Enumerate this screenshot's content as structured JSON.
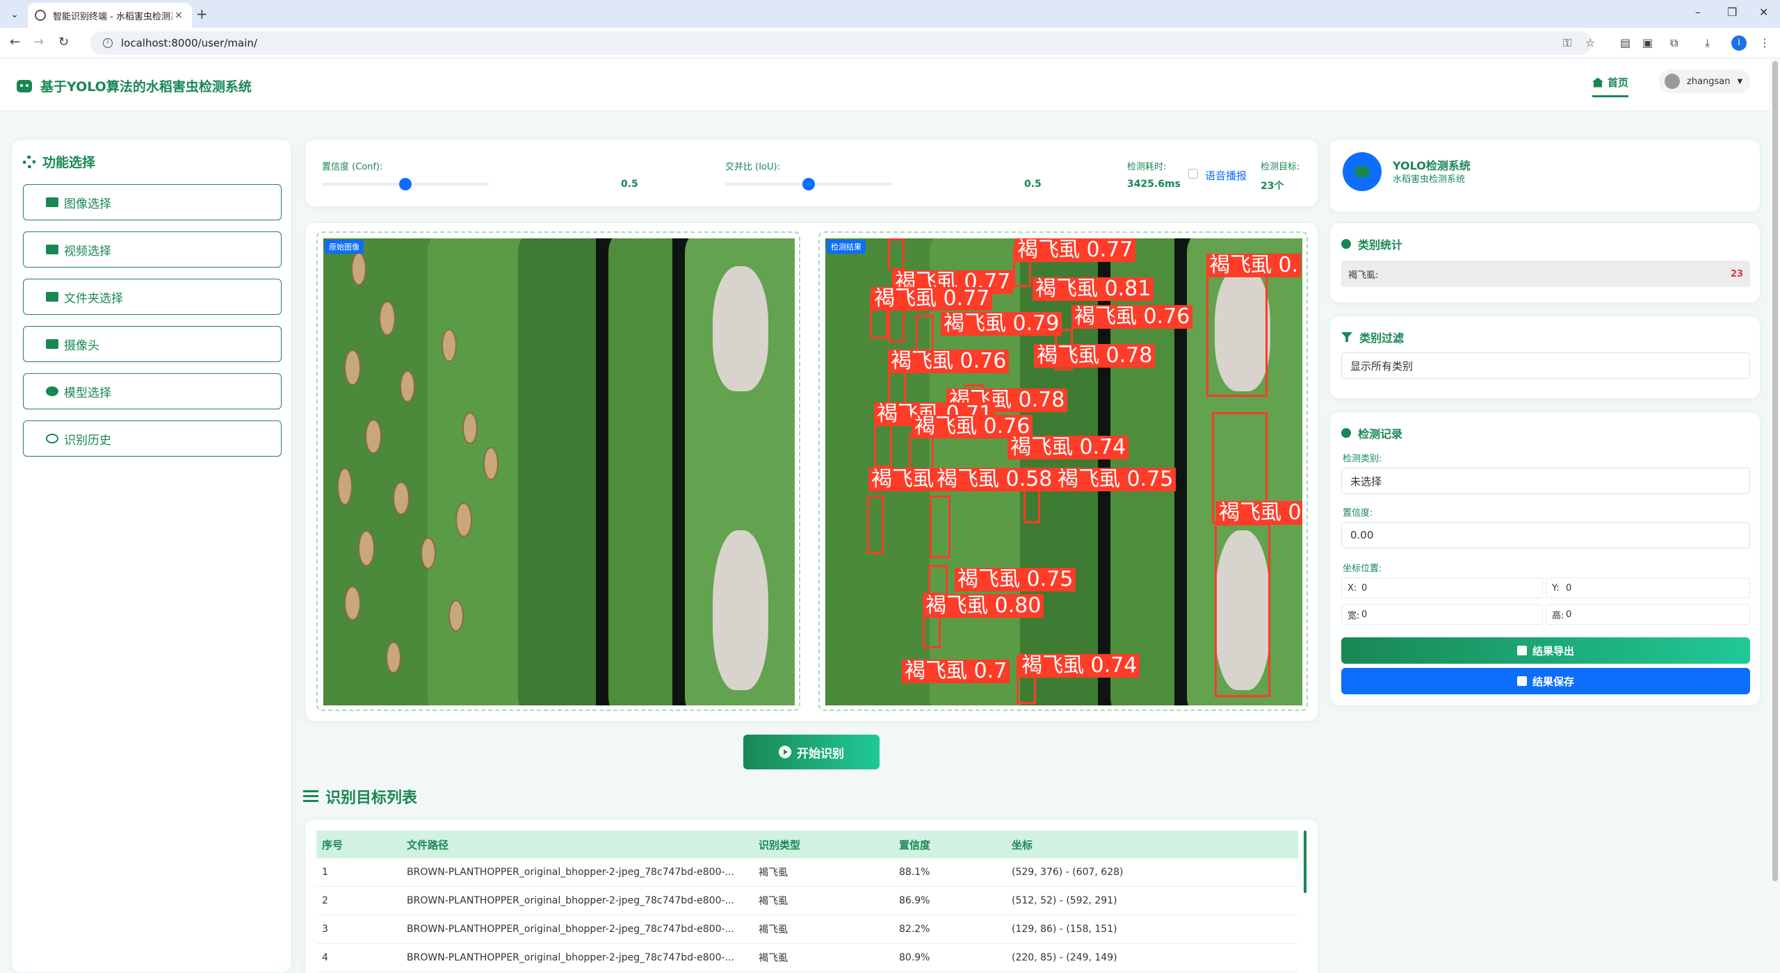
{
  "browser": {
    "tab_title": "智能识别终端 - 水稻害虫检测系统",
    "tab_close": "×",
    "new_tab": "+",
    "url": "localhost:8000/user/main/"
  },
  "header": {
    "brand": "基于YOLO算法的水稻害虫检测系统",
    "home_label": "首页",
    "username": "zhangsan"
  },
  "sidebar": {
    "heading": "功能选择",
    "items": [
      {
        "label": "图像选择",
        "icon": "image-icon"
      },
      {
        "label": "视频选择",
        "icon": "video-icon"
      },
      {
        "label": "文件夹选择",
        "icon": "folder-icon"
      },
      {
        "label": "摄像头",
        "icon": "camera-icon"
      },
      {
        "label": "模型选择",
        "icon": "brain-icon"
      },
      {
        "label": "识别历史",
        "icon": "history-icon"
      }
    ]
  },
  "controls": {
    "conf_label": "置信度 (Conf):",
    "conf_value": "0.5",
    "conf_fraction": 0.5,
    "iou_label": "交并比 (IoU):",
    "iou_value": "0.5",
    "iou_fraction": 0.5,
    "time_label": "检测耗时:",
    "time_value": "3425.6ms",
    "voice_label": "语音播报",
    "voice_checked": false,
    "target_label": "检测目标:",
    "target_value": "23个"
  },
  "images": {
    "original_badge": "原始图像",
    "result_badge": "检测结果",
    "detections": [
      "褐飞虱 0.77",
      "褐飞虱 0.77",
      "褐飞虱 0.81",
      "褐飞虱 0.77",
      "褐飞虱 0.79",
      "褐飞虱 0.76",
      "褐飞虱 0.76",
      "褐飞虱 0.78",
      "褐飞虱 0.78",
      "褐飞虱 0.71",
      "褐飞虱 0.76",
      "褐飞虱 0.74",
      "褐飞虱",
      "褐飞虱 0.58",
      "褐飞虱 0.75",
      "褐飞虱 0.75",
      "褐飞虱 0.80",
      "褐飞虱 0.7",
      "褐飞虱 0.74",
      "褐飞虱 0.",
      "褐飞虱 0"
    ]
  },
  "start_button": "开始识别",
  "list": {
    "title": "识别目标列表",
    "columns": [
      "序号",
      "文件路径",
      "识别类型",
      "置信度",
      "坐标"
    ],
    "rows": [
      [
        "1",
        "BROWN-PLANTHOPPER_original_bhopper-2-jpeg_78c747bd-e800-...",
        "褐飞虱",
        "88.1%",
        "(529, 376) - (607, 628)"
      ],
      [
        "2",
        "BROWN-PLANTHOPPER_original_bhopper-2-jpeg_78c747bd-e800-...",
        "褐飞虱",
        "86.9%",
        "(512, 52) - (592, 291)"
      ],
      [
        "3",
        "BROWN-PLANTHOPPER_original_bhopper-2-jpeg_78c747bd-e800-...",
        "褐飞虱",
        "82.2%",
        "(129, 86) - (158, 151)"
      ],
      [
        "4",
        "BROWN-PLANTHOPPER_original_bhopper-2-jpeg_78c747bd-e800-...",
        "褐飞虱",
        "80.9%",
        "(220, 85) - (249, 149)"
      ]
    ]
  },
  "right": {
    "sys_title": "YOLO检测系统",
    "sys_subtitle": "水稻害虫检测系统",
    "stats_title": "类别统计",
    "stat_name": "褐飞虱:",
    "stat_count": "23",
    "filter_title": "类别过滤",
    "filter_value": "显示所有类别",
    "record_title": "检测记录",
    "class_label": "检测类别:",
    "class_value": "未选择",
    "conf_label": "置信度:",
    "conf_value": "0.00",
    "coord_label": "坐标位置:",
    "x_label": "X:",
    "x_value": "0",
    "y_label": "Y:",
    "y_value": "0",
    "w_label": "宽:",
    "w_value": "0",
    "h_label": "高:",
    "h_value": "0",
    "export_label": "结果导出",
    "save_label": "结果保存"
  },
  "colors": {
    "primary_green": "#198754",
    "accent_blue": "#0d6efd",
    "detection_red": "#ff3c28"
  }
}
